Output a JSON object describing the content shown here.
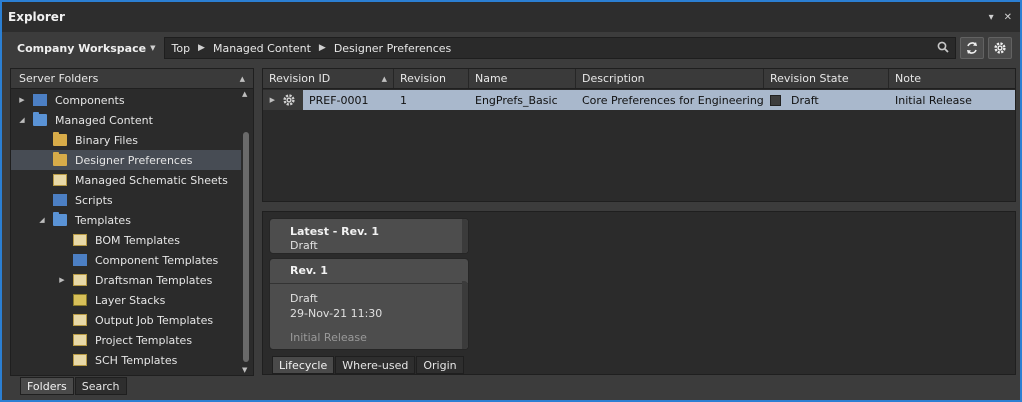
{
  "window": {
    "title": "Explorer",
    "pin_glyph": "▾",
    "close_glyph": "✕"
  },
  "toolbar": {
    "workspace_label": "Company Workspace",
    "breadcrumbs": [
      "Top",
      "Managed Content",
      "Designer Preferences"
    ]
  },
  "server_folders": {
    "header": "Server Folders",
    "items": [
      {
        "label": "Components",
        "indent": 0,
        "expander": "▶",
        "icon": "components-icon"
      },
      {
        "label": "Managed Content",
        "indent": 0,
        "expander": "◢",
        "icon": "folder-icon"
      },
      {
        "label": "Binary Files",
        "indent": 1,
        "expander": "",
        "icon": "binary-files-icon"
      },
      {
        "label": "Designer Preferences",
        "indent": 1,
        "expander": "",
        "icon": "preferences-folder-icon",
        "selected": true
      },
      {
        "label": "Managed Schematic Sheets",
        "indent": 1,
        "expander": "",
        "icon": "schematic-sheets-icon"
      },
      {
        "label": "Scripts",
        "indent": 1,
        "expander": "",
        "icon": "scripts-icon"
      },
      {
        "label": "Templates",
        "indent": 1,
        "expander": "◢",
        "icon": "folder-icon"
      },
      {
        "label": "BOM Templates",
        "indent": 2,
        "expander": "",
        "icon": "bom-templates-icon"
      },
      {
        "label": "Component Templates",
        "indent": 2,
        "expander": "",
        "icon": "component-templates-icon"
      },
      {
        "label": "Draftsman Templates",
        "indent": 2,
        "expander": "▶",
        "icon": "draftsman-templates-icon"
      },
      {
        "label": "Layer Stacks",
        "indent": 2,
        "expander": "",
        "icon": "layer-stacks-icon"
      },
      {
        "label": "Output Job Templates",
        "indent": 2,
        "expander": "",
        "icon": "output-job-templates-icon"
      },
      {
        "label": "Project Templates",
        "indent": 2,
        "expander": "",
        "icon": "project-templates-icon"
      },
      {
        "label": "SCH Templates",
        "indent": 2,
        "expander": "",
        "icon": "sch-templates-icon"
      }
    ],
    "tabs": [
      "Folders",
      "Search"
    ]
  },
  "revisions": {
    "columns": [
      "Revision ID",
      "Revision",
      "Name",
      "Description",
      "Revision State",
      "Note"
    ],
    "rows": [
      {
        "revision_id": "PREF-0001",
        "revision": "1",
        "name": "EngPrefs_Basic",
        "description": "Core Preferences for Engineering",
        "state": "Draft",
        "note": "Initial Release"
      }
    ]
  },
  "lifecycle": {
    "latest_card": {
      "title": "Latest - Rev.  1",
      "state": "Draft"
    },
    "rev_card": {
      "title": "Rev. 1",
      "state": "Draft",
      "date": "29-Nov-21 11:30",
      "note": "Initial Release"
    },
    "tabs": [
      "Lifecycle",
      "Where-used",
      "Origin"
    ]
  }
}
